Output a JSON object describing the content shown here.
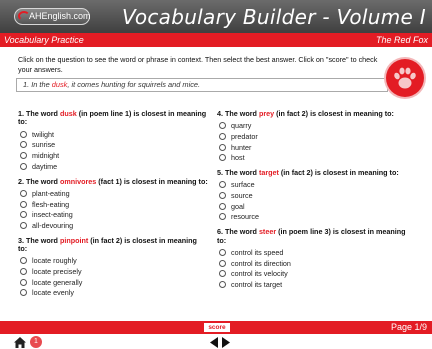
{
  "header": {
    "logo_text": "AHEnglish.com",
    "title": "Vocabulary Builder - Volume I"
  },
  "section_bar": {
    "left": "Vocabulary Practice",
    "right": "The Red Fox"
  },
  "instructions": "Click on the question to see the word or phrase in context.  Then select the best answer. Click on \"score\" to check your answers.",
  "passage": {
    "prefix": "1. In the ",
    "highlight": "dusk",
    "suffix": ", it comes hunting for squirrels and mice."
  },
  "questions_left": [
    {
      "pre": "1. The word ",
      "word": "dusk",
      "post": " (in poem line 1) is closest in meaning to:",
      "options": [
        "twilight",
        "sunrise",
        "midnight",
        "daytime"
      ]
    },
    {
      "pre": "2. The word ",
      "word": "omnivores",
      "post": " (fact 1) is closest in meaning to:",
      "options": [
        "plant-eating",
        "flesh-eating",
        "insect-eating",
        "all-devouring"
      ]
    },
    {
      "pre": "3. The word ",
      "word": "pinpoint",
      "post": " (in fact 2) is closest in meaning to:",
      "options": [
        "locate roughly",
        "locate precisely",
        "locate generally",
        "locate evenly"
      ]
    }
  ],
  "questions_right": [
    {
      "pre": "4. The word ",
      "word": "prey",
      "post": " (in fact 2) is closest in meaning to:",
      "options": [
        "quarry",
        "predator",
        "hunter",
        "host"
      ]
    },
    {
      "pre": "5. The word ",
      "word": "target",
      "post": " (in fact 2) is closest in meaning to:",
      "options": [
        "surface",
        "source",
        "goal",
        "resource"
      ]
    },
    {
      "pre": "6. The word ",
      "word": "steer",
      "post": " (in poem line 3) is closest in meaning to:",
      "options": [
        "control its speed",
        "control its direction",
        "control its velocity",
        "control its target"
      ]
    }
  ],
  "footer": {
    "score_label": "score",
    "page_label": "Page 1/9",
    "badge_count": "1"
  },
  "icons": {
    "home": "home-icon",
    "paw": "paw-print-icon",
    "prev": "prev-arrow-icon",
    "next": "next-arrow-icon"
  },
  "colors": {
    "accent_red": "#e31c24",
    "header_gray": "#555555"
  }
}
